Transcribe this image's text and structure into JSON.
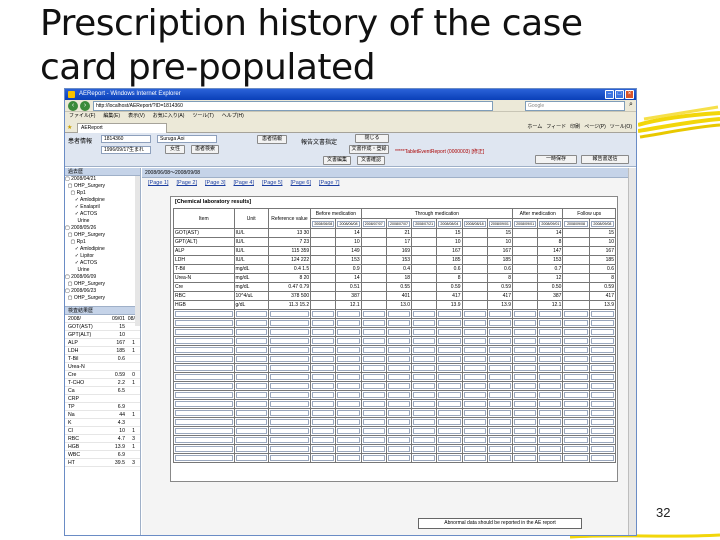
{
  "slide": {
    "title": "Prescription history of the case card pre-populated",
    "page_number": "32",
    "accent_color": "#f2d60a"
  },
  "browser": {
    "window_title": "AEReport - Windows Internet Explorer",
    "url": "http://localhost/AEReport/?ID=1814360",
    "search_placeholder": "Google",
    "menu": [
      "ファイル(F)",
      "編集(E)",
      "表示(V)",
      "お気に入り(A)",
      "ツール(T)",
      "ヘルプ(H)"
    ],
    "tab_label": "AEReport",
    "tab_tools": [
      "ホーム",
      "フィード",
      "印刷",
      "ページ(P)",
      "ツール(O)"
    ]
  },
  "header": {
    "patient_label": "患者情報",
    "patient_id": "1814360",
    "patient_name": "Suruga  Aoi",
    "birth": "1996/09/17生まれ",
    "sex": "女性",
    "btn_patient_info": "患者情報",
    "btn_search": "患者検索",
    "report_label": "報告文書指定",
    "btn_close": "閉じる",
    "btn_draft": "文書作成・登録",
    "btn_edit": "文書編集",
    "btn_confirm": "文書確認",
    "report_name": "*****TabletEventReport (0000003) [修正]",
    "btn_save_draft": "一時保存",
    "btn_send": "報告書送信"
  },
  "left_panel": {
    "history_label": "過去歴",
    "tree": [
      "▢ 2008/04/21",
      "  ▢ OHP_Surgery",
      "    ▢ Rp1",
      "       ✓ Amlodipine",
      "       ✓ Enalapril",
      "       ✓ ACTOS",
      "         Urine",
      "▢ 2008/05/26",
      "  ▢ OHP_Surgery",
      "    ▢ Rp1",
      "       ✓ Amlodipine",
      "       ✓ Lipitor",
      "       ✓ ACTOS",
      "         Urine",
      "▢ 2008/06/09",
      "  ▢ OHP_Surgery",
      "▢ 2008/06/23",
      "  ▢ OHP_Surgery"
    ],
    "lab_label": "検査結果歴",
    "lab_dates": [
      "2008/",
      "09/01",
      "08/"
    ],
    "labs": [
      {
        "name": "GOT(AST)",
        "value": "15",
        "flag": ""
      },
      {
        "name": "GPT(ALT)",
        "value": "10",
        "flag": ""
      },
      {
        "name": "ALP",
        "value": "167",
        "flag": "1"
      },
      {
        "name": "LDH",
        "value": "185",
        "flag": "1"
      },
      {
        "name": "T-Bil",
        "value": "0.6",
        "flag": ""
      },
      {
        "name": "Urea-N",
        "value": "",
        "flag": ""
      },
      {
        "name": "Cre",
        "value": "0.59",
        "flag": "0"
      },
      {
        "name": "T-CHO",
        "value": "2.2",
        "flag": "1"
      },
      {
        "name": "Ca",
        "value": "6.5",
        "flag": ""
      },
      {
        "name": "CRP",
        "value": "",
        "flag": ""
      },
      {
        "name": "TP",
        "value": "6.9",
        "flag": ""
      },
      {
        "name": "Na",
        "value": "44",
        "flag": "1"
      },
      {
        "name": "K",
        "value": "4.3",
        "flag": ""
      },
      {
        "name": "Cl",
        "value": "10",
        "flag": "1"
      },
      {
        "name": "RBC",
        "value": "4.7",
        "flag": "3"
      },
      {
        "name": "HGB",
        "value": "13.9",
        "flag": "1"
      },
      {
        "name": "WBC",
        "value": "6.9",
        "flag": ""
      },
      {
        "name": "HT",
        "value": "39.5",
        "flag": "3"
      }
    ]
  },
  "report": {
    "range_label": "2008/06/08～2008/09/08",
    "pages": [
      "[Page 1]",
      "[Page 2]",
      "[Page 3]",
      "[Page 4]",
      "[Page 5]",
      "[Page 6]",
      "[Page 7]"
    ],
    "sheet_title": "[Chemical laboratory results]",
    "col_item": "Item",
    "col_unit": "Unit",
    "col_ref": "Reference value",
    "col_before": "Before medication",
    "col_through": "Through medication",
    "col_after": "After medication",
    "col_follow": "Follow ups",
    "dates": [
      "2008/06/08",
      "2008/07/07",
      "2008/07/21",
      "2008/08/04",
      "2008/08/18",
      "2008/09/01",
      "2008/09/01",
      "2008/09/08"
    ],
    "rows": [
      {
        "item": "GOT(AST)",
        "unit": "IU/L",
        "ref": "13",
        "ref2": "30",
        "vals": [
          "14",
          "21",
          "15",
          "15",
          "14",
          "15"
        ]
      },
      {
        "item": "GPT(ALT)",
        "unit": "IU/L",
        "ref": "7",
        "ref2": "23",
        "vals": [
          "10",
          "17",
          "10",
          "10",
          "8",
          "10"
        ]
      },
      {
        "item": "ALP",
        "unit": "IU/L",
        "ref": "115",
        "ref2": "359",
        "vals": [
          "149",
          "169",
          "167",
          "167",
          "147",
          "167"
        ]
      },
      {
        "item": "LDH",
        "unit": "IU/L",
        "ref": "124",
        "ref2": "222",
        "vals": [
          "153",
          "153",
          "185",
          "185",
          "153",
          "185"
        ]
      },
      {
        "item": "T-Bil",
        "unit": "mg/dL",
        "ref": "0.4",
        "ref2": "1.5",
        "vals": [
          "0.9",
          "0.4",
          "0.6",
          "0.6",
          "0.7",
          "0.6"
        ]
      },
      {
        "item": "Urea-N",
        "unit": "mg/dL",
        "ref": "8",
        "ref2": "20",
        "vals": [
          "14",
          "18",
          "8",
          "8",
          "12",
          "8"
        ]
      },
      {
        "item": "Cre",
        "unit": "mg/dL",
        "ref": "0.47",
        "ref2": "0.79",
        "vals": [
          "0.51",
          "0.55",
          "0.59",
          "0.59",
          "0.50",
          "0.59"
        ]
      },
      {
        "item": "RBC",
        "unit": "10^4/uL",
        "ref": "378",
        "ref2": "500",
        "vals": [
          "387",
          "401",
          "417",
          "417",
          "387",
          "417"
        ]
      },
      {
        "item": "HGB",
        "unit": "g/dL",
        "ref": "11.3",
        "ref2": "15.2",
        "vals": [
          "12.1",
          "13.0",
          "13.9",
          "13.9",
          "12.1",
          "13.9"
        ]
      }
    ],
    "note": "Abnormal data should be reported in the AE report"
  }
}
